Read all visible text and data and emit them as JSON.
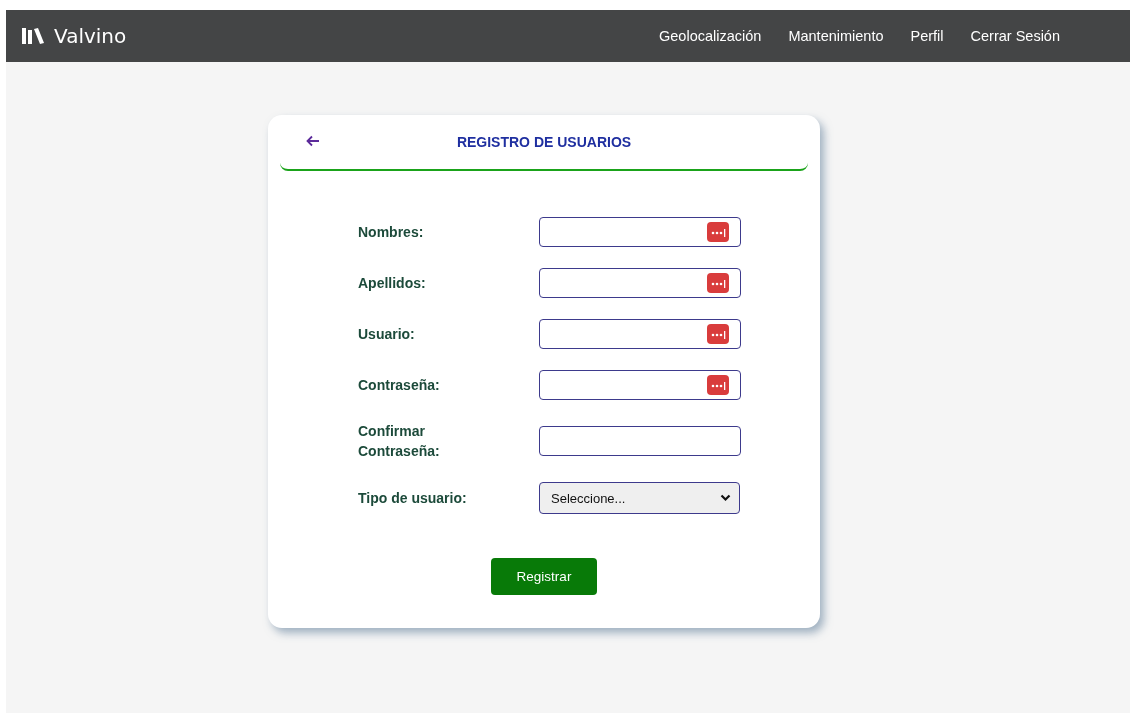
{
  "navbar": {
    "brand": "Valvino",
    "links": [
      "Geolocalización",
      "Mantenimiento",
      "Perfil",
      "Cerrar Sesión"
    ]
  },
  "form": {
    "title": "REGISTRO DE USUARIOS",
    "fields": [
      {
        "kind": "text",
        "label": "Nombres:",
        "autofill_icon": true
      },
      {
        "kind": "text",
        "label": "Apellidos:",
        "autofill_icon": true
      },
      {
        "kind": "text",
        "label": "Usuario:",
        "autofill_icon": true
      },
      {
        "kind": "text",
        "label": "Contraseña:",
        "autofill_icon": true
      },
      {
        "kind": "text",
        "label": "Confirmar Contraseña:",
        "autofill_icon": false
      },
      {
        "kind": "select",
        "label": "Tipo de usuario:",
        "value": "Seleccione..."
      }
    ],
    "submit": "Registrar"
  }
}
